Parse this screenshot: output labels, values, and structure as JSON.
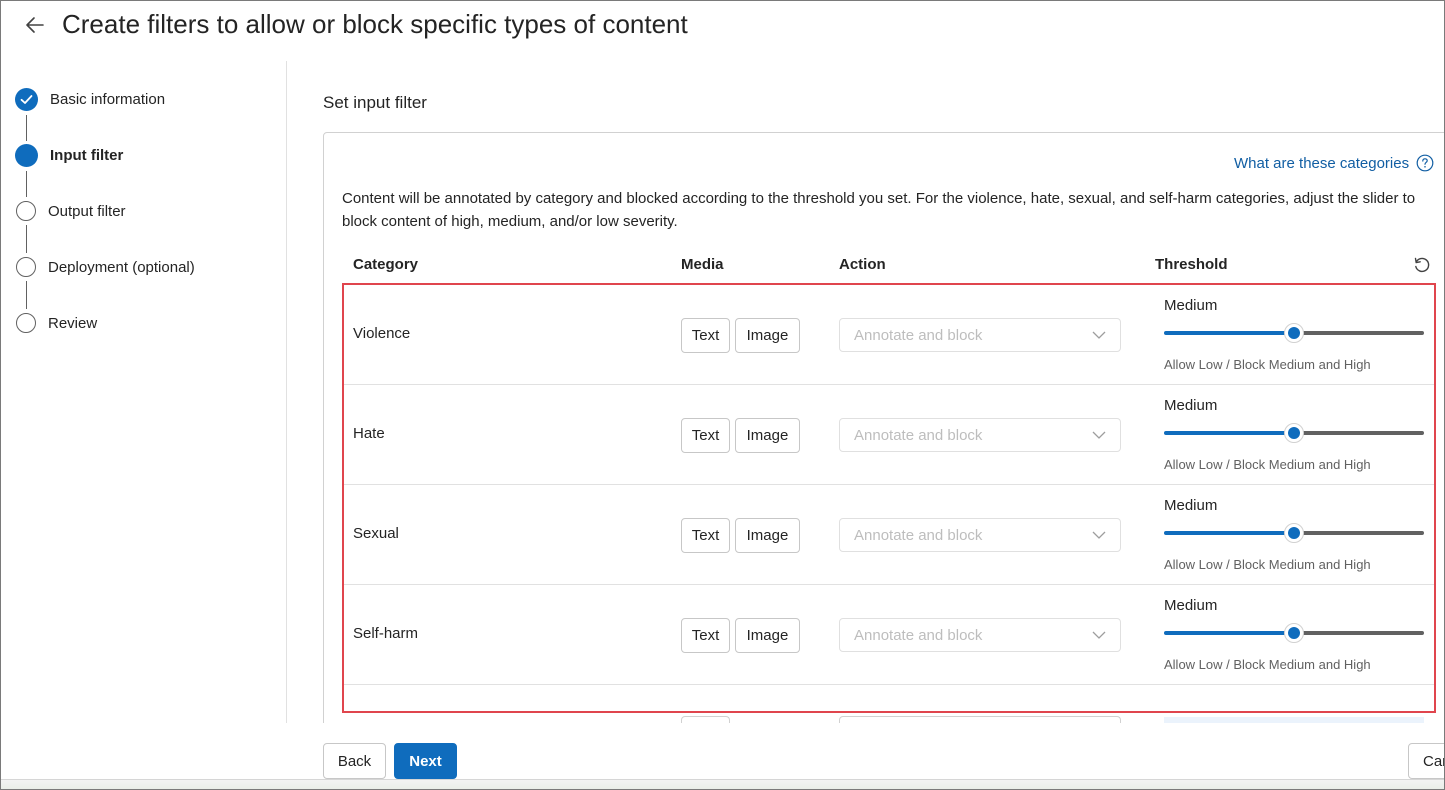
{
  "header": {
    "title": "Create filters to allow or block specific types of content"
  },
  "stepper": [
    {
      "label": "Basic information",
      "state": "done"
    },
    {
      "label": "Input filter",
      "state": "current"
    },
    {
      "label": "Output filter",
      "state": "pending"
    },
    {
      "label": "Deployment (optional)",
      "state": "pending"
    },
    {
      "label": "Review",
      "state": "pending"
    }
  ],
  "main": {
    "section_title": "Set input filter",
    "help_link": "What are these categories",
    "description": "Content will be annotated by category and blocked according to the threshold you set. For the violence, hate, sexual, and self-harm categories, adjust the slider to block content of high, medium, and/or low severity.",
    "columns": {
      "category": "Category",
      "media": "Media",
      "action": "Action",
      "threshold": "Threshold"
    },
    "rows": [
      {
        "category": "Violence",
        "media_text": "Text",
        "media_image": "Image",
        "action": "Annotate and block",
        "threshold_level": "Medium",
        "threshold_fraction": 0.5,
        "threshold_desc": "Allow Low / Block Medium and High"
      },
      {
        "category": "Hate",
        "media_text": "Text",
        "media_image": "Image",
        "action": "Annotate and block",
        "threshold_level": "Medium",
        "threshold_fraction": 0.5,
        "threshold_desc": "Allow Low / Block Medium and High"
      },
      {
        "category": "Sexual",
        "media_text": "Text",
        "media_image": "Image",
        "action": "Annotate and block",
        "threshold_level": "Medium",
        "threshold_fraction": 0.5,
        "threshold_desc": "Allow Low / Block Medium and High"
      },
      {
        "category": "Self-harm",
        "media_text": "Text",
        "media_image": "Image",
        "action": "Annotate and block",
        "threshold_level": "Medium",
        "threshold_fraction": 0.5,
        "threshold_desc": "Allow Low / Block Medium and High"
      }
    ]
  },
  "footer": {
    "back_label": "Back",
    "next_label": "Next",
    "cancel_label": "Car"
  },
  "colors": {
    "accent": "#0f6cbd",
    "link": "#115ea3",
    "highlight": "#e0454d"
  },
  "icons": {
    "back": "arrow-left-icon",
    "help": "question-circle-icon",
    "reset": "reset-icon",
    "check": "checkmark-icon",
    "chevron": "chevron-down-icon"
  }
}
